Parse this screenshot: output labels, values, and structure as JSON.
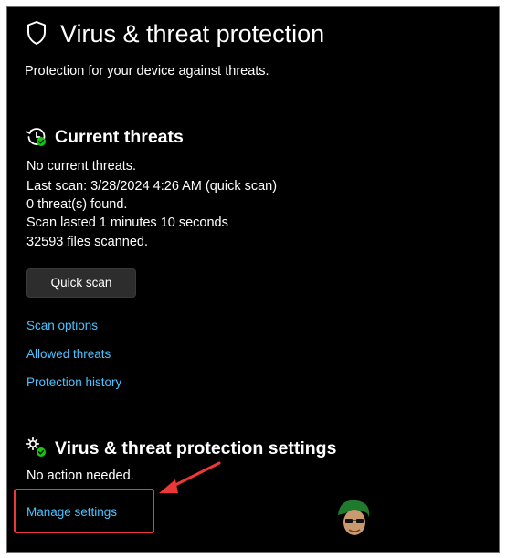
{
  "header": {
    "title": "Virus & threat protection",
    "subtitle": "Protection for your device against threats.",
    "icon": "shield-icon"
  },
  "current_threats": {
    "heading": "Current threats",
    "icon": "scan-history-icon",
    "lines": [
      "No current threats.",
      "Last scan: 3/28/2024 4:26 AM (quick scan)",
      "0 threat(s) found.",
      "Scan lasted 1 minutes 10 seconds",
      "32593 files scanned."
    ],
    "quick_scan_label": "Quick scan",
    "links": {
      "scan_options": "Scan options",
      "allowed_threats": "Allowed threats",
      "protection_history": "Protection history"
    }
  },
  "settings": {
    "heading": "Virus & threat protection settings",
    "icon": "settings-gears-icon",
    "status": "No action needed.",
    "manage_link": "Manage settings"
  },
  "annotation": {
    "highlight_color": "#ee3737",
    "arrow_color": "#ee3737"
  },
  "colors": {
    "background": "#000000",
    "link": "#4cc2ff",
    "status_green": "#16c60c"
  }
}
